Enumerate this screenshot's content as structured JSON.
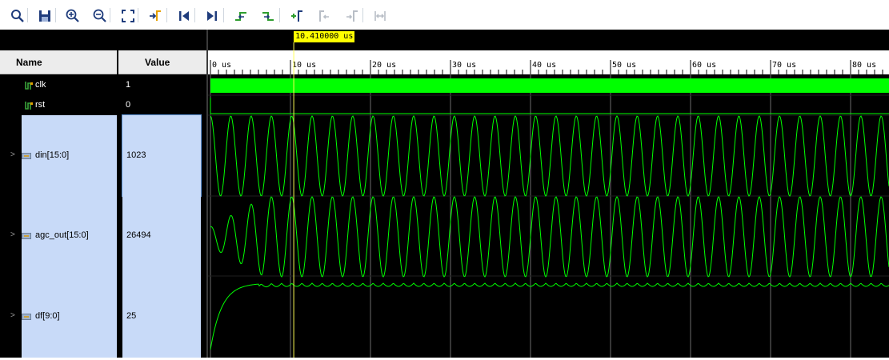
{
  "toolbar": {
    "buttons": [
      {
        "icon": "search-icon"
      },
      {
        "icon": "save-icon"
      },
      {
        "icon": "zoom-in-icon"
      },
      {
        "icon": "zoom-out-icon"
      },
      {
        "icon": "zoom-fit-icon"
      },
      {
        "icon": "go-to-cursor-icon"
      },
      {
        "icon": "go-to-time-zero-icon"
      },
      {
        "icon": "go-to-last-time-icon"
      },
      {
        "icon": "previous-transition-icon"
      },
      {
        "icon": "next-transition-icon"
      },
      {
        "icon": "add-marker-icon"
      },
      {
        "icon": "previous-marker-icon"
      },
      {
        "icon": "next-marker-icon"
      },
      {
        "icon": "swap-cursors-icon"
      }
    ]
  },
  "panel": {
    "name_header": "Name",
    "value_header": "Value"
  },
  "signals": [
    {
      "name": "clk",
      "value": "1",
      "icon": "bit-signal-icon",
      "bus": false
    },
    {
      "name": "rst",
      "value": "0",
      "icon": "bit-signal-icon",
      "bus": false
    },
    {
      "name": "din[15:0]",
      "value": "1023",
      "icon": "bus-signal-icon",
      "bus": true
    },
    {
      "name": "agc_out[15:0]",
      "value": "26494",
      "icon": "bus-signal-icon",
      "bus": true
    },
    {
      "name": "df[9:0]",
      "value": "25",
      "icon": "bus-signal-icon",
      "bus": true
    }
  ],
  "timeline": {
    "cursor_label": "10.410000 us",
    "cursor_time_us": 10.41,
    "ticks": [
      "0 us",
      "10 us",
      "20 us",
      "30 us",
      "40 us",
      "50 us",
      "60 us",
      "70 us",
      "80 us"
    ],
    "tick_values_us": [
      0,
      10,
      20,
      30,
      40,
      50,
      60,
      70,
      80
    ]
  },
  "colors": {
    "wave": "#00ff00",
    "cursor": "#ffff00",
    "selection": "#c8daf8",
    "grid": "#6b6b6b"
  }
}
